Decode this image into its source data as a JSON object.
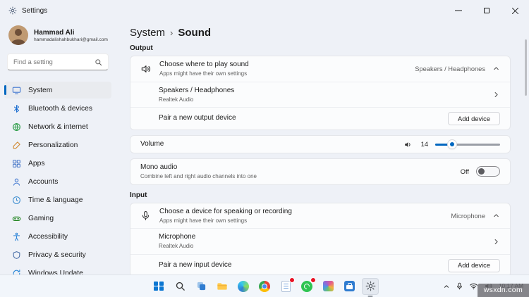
{
  "window": {
    "title": "Settings"
  },
  "sidebar": {
    "user": {
      "name": "Hammad Ali",
      "email": "hammadalishahbukhari@gmail.com"
    },
    "search": {
      "placeholder": "Find a setting"
    },
    "items": [
      {
        "label": "System"
      },
      {
        "label": "Bluetooth & devices"
      },
      {
        "label": "Network & internet"
      },
      {
        "label": "Personalization"
      },
      {
        "label": "Apps"
      },
      {
        "label": "Accounts"
      },
      {
        "label": "Time & language"
      },
      {
        "label": "Gaming"
      },
      {
        "label": "Accessibility"
      },
      {
        "label": "Privacy & security"
      },
      {
        "label": "Windows Update"
      }
    ]
  },
  "breadcrumb": {
    "root": "System",
    "separator": "›",
    "current": "Sound"
  },
  "output": {
    "label": "Output",
    "choose": {
      "title": "Choose where to play sound",
      "subtitle": "Apps might have their own settings",
      "value": "Speakers / Headphones"
    },
    "device": {
      "title": "Speakers / Headphones",
      "subtitle": "Realtek Audio"
    },
    "pair": {
      "title": "Pair a new output device",
      "button": "Add device"
    },
    "volume": {
      "label": "Volume",
      "value": "14"
    },
    "mono": {
      "title": "Mono audio",
      "subtitle": "Combine left and right audio channels into one",
      "state": "Off"
    }
  },
  "input": {
    "label": "Input",
    "choose": {
      "title": "Choose a device for speaking or recording",
      "subtitle": "Apps might have their own settings",
      "value": "Microphone"
    },
    "device": {
      "title": "Microphone",
      "subtitle": "Realtek Audio"
    },
    "pair": {
      "title": "Pair a new input device",
      "button": "Add device"
    }
  },
  "taskbar": {
    "clock": {
      "time": "10:17 AM"
    }
  },
  "watermark": {
    "text": "wsxdn.com"
  },
  "colors": {
    "accent": "#0067c0",
    "badge": "#e81123"
  },
  "icons": {
    "titlebar": "settings-gear, minimize, maximize, close",
    "sidebar": "system, bluetooth, network, personalization, apps, accounts, time-language, gaming, accessibility, privacy, windows-update",
    "content": "speaker, microphone, chevron-up, chevron-right, volume",
    "taskbar": "start, search, task-view, file-explorer, edge, chrome, notepad, whatsapp, photos, store, settings",
    "tray": "chevron-up, microphone, wifi, volume"
  }
}
